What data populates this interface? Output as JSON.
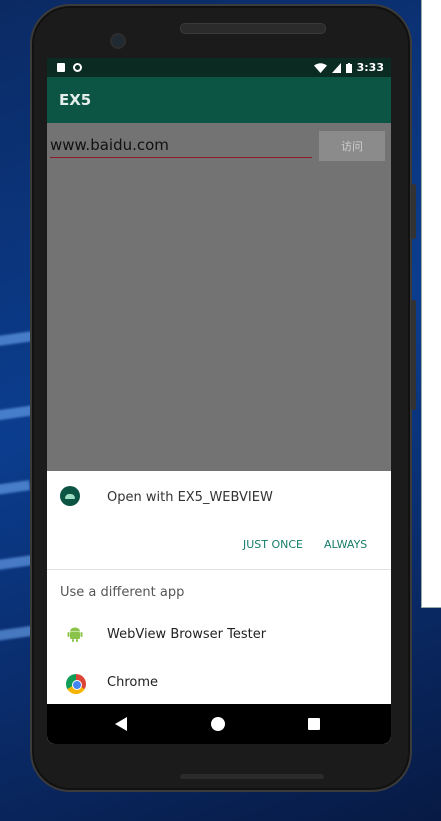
{
  "status_bar": {
    "time": "3:33"
  },
  "app": {
    "title": "EX5"
  },
  "url_bar": {
    "value": "www.baidu.com",
    "visit_label": "访问"
  },
  "chooser": {
    "title": "Open with EX5_WEBVIEW",
    "just_once_label": "JUST ONCE",
    "always_label": "ALWAYS",
    "different_app_label": "Use a different app",
    "apps": [
      {
        "name": "WebView Browser Tester",
        "icon": "android-robot-icon"
      },
      {
        "name": "Chrome",
        "icon": "chrome-icon"
      }
    ]
  },
  "colors": {
    "app_bar": "#0c5444",
    "accent": "#167c69",
    "input_underline": "#8c1a2a"
  }
}
